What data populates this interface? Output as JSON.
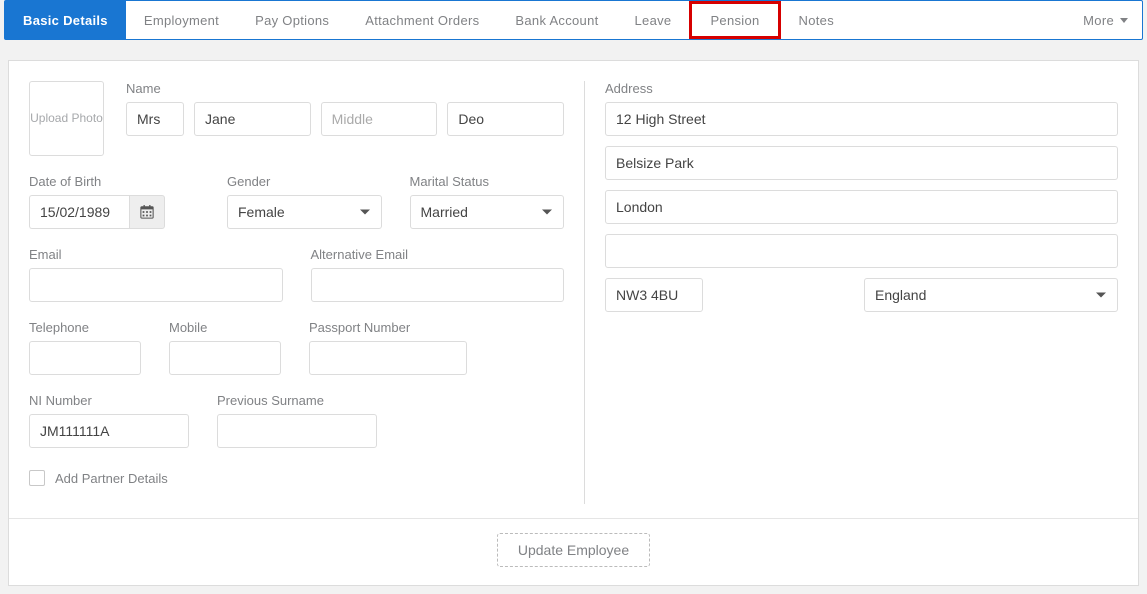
{
  "tabs": {
    "basic": "Basic Details",
    "employment": "Employment",
    "pay": "Pay Options",
    "attach": "Attachment Orders",
    "bank": "Bank Account",
    "leave": "Leave",
    "pension": "Pension",
    "notes": "Notes",
    "more": "More"
  },
  "upload_photo": "Upload Photo",
  "labels": {
    "name": "Name",
    "dob": "Date of Birth",
    "gender": "Gender",
    "marital": "Marital Status",
    "email": "Email",
    "alt_email": "Alternative Email",
    "telephone": "Telephone",
    "mobile": "Mobile",
    "passport": "Passport Number",
    "ni": "NI Number",
    "prev_surname": "Previous Surname",
    "partner": "Add Partner Details",
    "address": "Address"
  },
  "name": {
    "title": "Mrs",
    "first": "Jane",
    "middle_ph": "Middle",
    "middle": "",
    "last": "Deo"
  },
  "dob": "15/02/1989",
  "gender": "Female",
  "marital": "Married",
  "email": "",
  "alt_email": "",
  "telephone": "",
  "mobile": "",
  "passport": "",
  "ni": "JM111111A",
  "prev_surname": "",
  "address": {
    "line1": "12 High Street",
    "line2": "Belsize Park",
    "line3": "London",
    "line4": "",
    "postcode": "NW3 4BU",
    "country": "England"
  },
  "update_btn": "Update Employee"
}
